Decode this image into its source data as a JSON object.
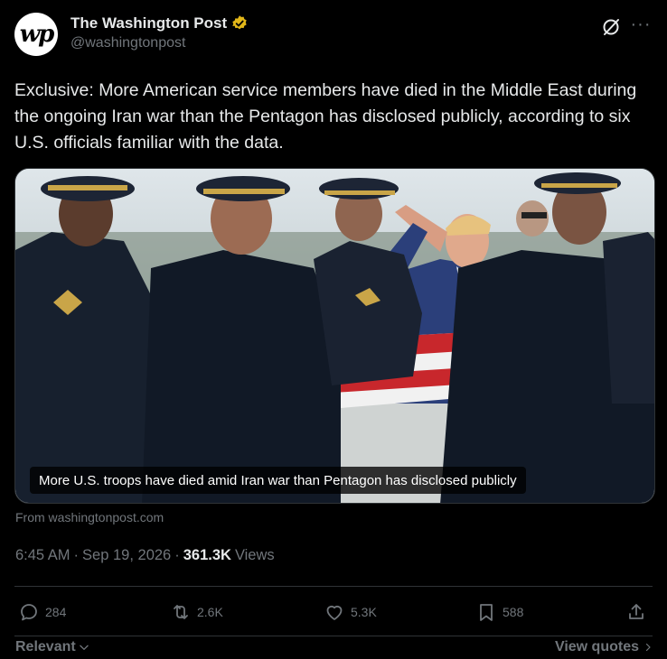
{
  "author": {
    "display_name": "The Washington Post",
    "handle": "@washingtonpost",
    "avatar_text": "wp",
    "verified_color": "#e2b719"
  },
  "tweet": {
    "text": "Exclusive: More American service members have died in the Middle East during the ongoing Iran war than the Pentagon has disclosed publicly, according to six U.S. officials familiar with the data."
  },
  "media": {
    "caption": "More U.S. troops have died amid Iran war than Pentagon has disclosed publicly",
    "source": "From washingtonpost.com"
  },
  "meta": {
    "time": "6:45 AM",
    "separator": "·",
    "date": "Sep 19, 2026",
    "views_count": "361.3K",
    "views_label": "Views"
  },
  "actions": {
    "replies": "284",
    "reposts": "2.6K",
    "likes": "5.3K",
    "bookmarks": "588"
  },
  "footer": {
    "sort_label": "Relevant",
    "quotes_label": "View quotes"
  },
  "icons": [
    "verified-icon",
    "grok-icon",
    "more-icon",
    "reply-icon",
    "repost-icon",
    "like-icon",
    "bookmark-icon",
    "share-icon",
    "chevron-down-icon",
    "chevron-right-icon"
  ]
}
